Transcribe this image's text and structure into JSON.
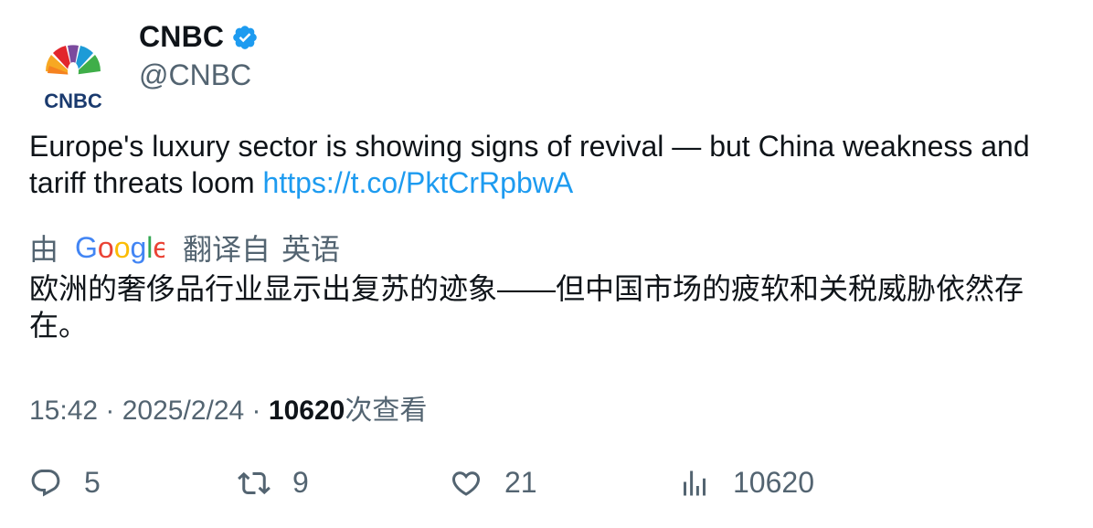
{
  "author": {
    "display_name": "CNBC",
    "handle": "@CNBC",
    "logo_text": "CNBC",
    "verified_icon": "verified-badge-icon",
    "accent_color": "#1d9bf0"
  },
  "tweet": {
    "text": "Europe's luxury sector is showing signs of revival — but China weakness and tariff threats loom ",
    "link": "https://t.co/PktCrRpbwA"
  },
  "translation": {
    "by_label": "由",
    "google_label": "Google",
    "from_label": "翻译自",
    "language": "英语",
    "translated_text": "欧洲的奢侈品行业显示出复苏的迹象——但中国市场的疲软和关税威胁依然存在。"
  },
  "meta": {
    "time": "15:42",
    "separator": " · ",
    "date": "2025/2/24",
    "views_count": "10620",
    "views_label": "次查看"
  },
  "actions": {
    "replies": "5",
    "retweets": "9",
    "likes": "21",
    "views": "10620"
  }
}
